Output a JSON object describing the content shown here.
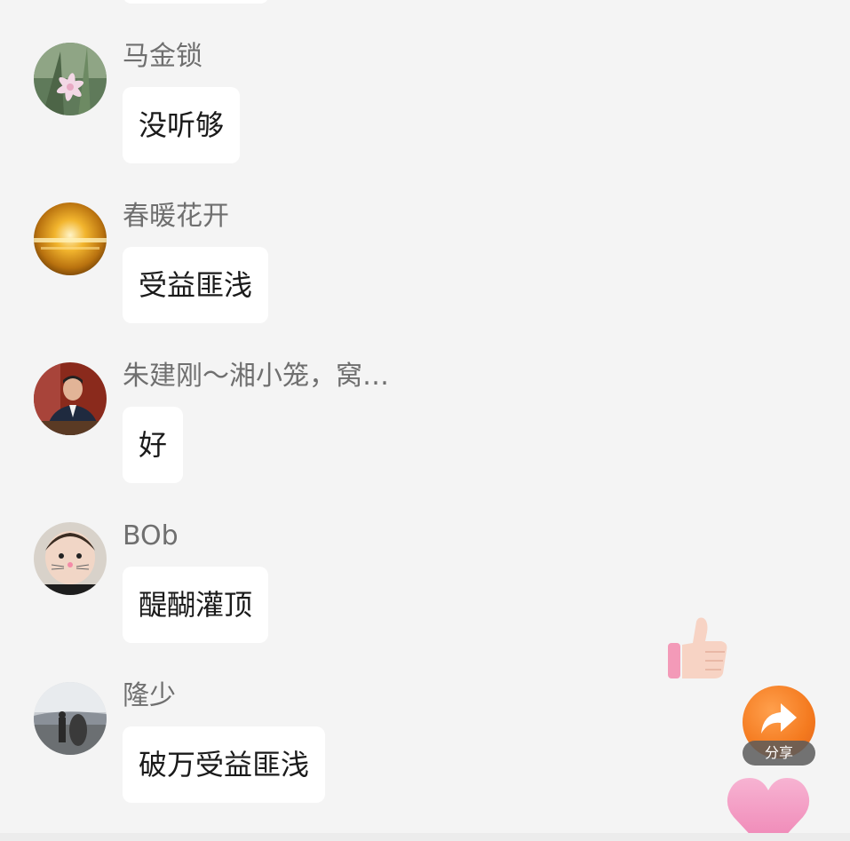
{
  "messages": [
    {
      "name": "马金锁",
      "text": "没听够"
    },
    {
      "name": "春暖花开",
      "text": "受益匪浅"
    },
    {
      "name": "朱建刚～湘小笼，窝…",
      "text": "好"
    },
    {
      "name": "BOb",
      "text": "醍醐灌顶"
    },
    {
      "name": "隆少",
      "text": "破万受益匪浅"
    }
  ],
  "floating": {
    "share_label": "分享",
    "like_icon": "thumbs-up-icon",
    "share_icon": "share-arrow-icon",
    "heart_icon": "heart-icon"
  },
  "colors": {
    "background": "#f4f4f4",
    "bubble": "#ffffff",
    "name_text": "#6f6f6f",
    "message_text": "#1a1a1a",
    "share_accent": "#f47a1f",
    "heart_pink": "#f49ac2"
  }
}
